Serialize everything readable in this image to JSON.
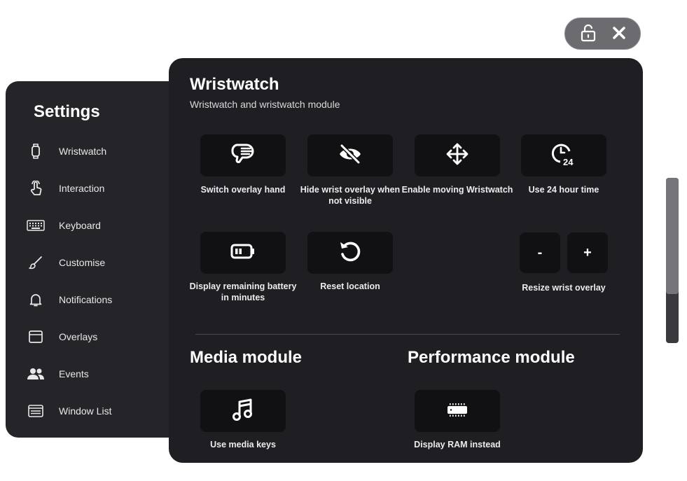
{
  "sidebar": {
    "title": "Settings",
    "items": [
      {
        "label": "Wristwatch",
        "icon": "watch-icon"
      },
      {
        "label": "Interaction",
        "icon": "pointer-hand-icon"
      },
      {
        "label": "Keyboard",
        "icon": "keyboard-icon"
      },
      {
        "label": "Customise",
        "icon": "brush-icon"
      },
      {
        "label": "Notifications",
        "icon": "bell-icon"
      },
      {
        "label": "Overlays",
        "icon": "window-icon"
      },
      {
        "label": "Events",
        "icon": "people-icon"
      },
      {
        "label": "Window List",
        "icon": "window-list-icon"
      }
    ]
  },
  "main": {
    "title": "Wristwatch",
    "subtitle": "Wristwatch and wristwatch module",
    "tiles": {
      "switch_hand": {
        "label": "Switch overlay hand",
        "icon": "hand-switch-icon"
      },
      "hide_wrist": {
        "label": "Hide wrist overlay when not visible",
        "icon": "eye-off-icon"
      },
      "enable_moving": {
        "label": "Enable moving Wristwatch",
        "icon": "move-arrows-icon"
      },
      "use_24h": {
        "label": "Use 24 hour time",
        "icon": "clock-24-icon"
      },
      "battery_minutes": {
        "label": "Display remaining battery in minutes",
        "icon": "battery-icon"
      },
      "reset_location": {
        "label": "Reset location",
        "icon": "reset-icon"
      }
    },
    "resize": {
      "label": "Resize wrist overlay",
      "minus": "-",
      "plus": "+"
    },
    "media": {
      "title": "Media module",
      "tile_label": "Use media keys",
      "icon": "music-note-icon"
    },
    "performance": {
      "title": "Performance module",
      "tile_label": "Display RAM instead",
      "icon": "ram-chip-icon"
    }
  },
  "topbar": {
    "lock_icon": "unlock-icon",
    "close_icon": "close-icon"
  }
}
